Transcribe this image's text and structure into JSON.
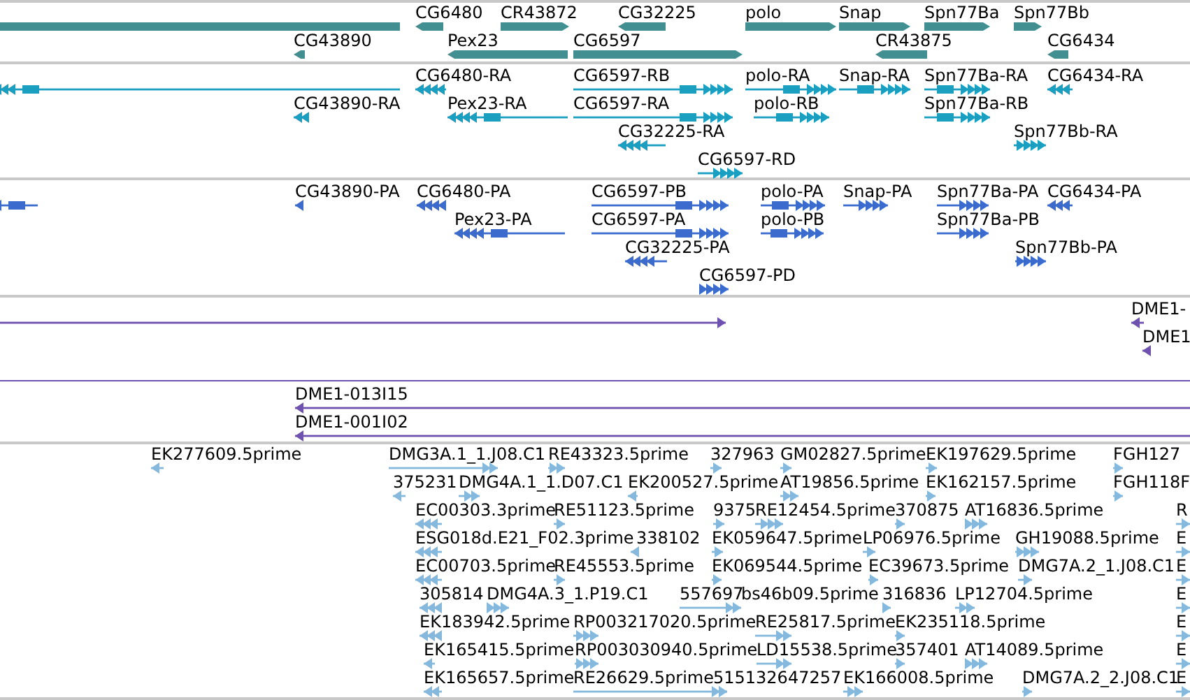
{
  "tracks": [
    {
      "kind": "gene",
      "color": "#428f92",
      "features": [
        {
          "reverse": true
        },
        {
          "label": "CG6480",
          "reverse": true
        },
        {
          "label": "CR43872",
          "reverse": false
        },
        {
          "label": "CG32225",
          "reverse": true
        },
        {
          "label": "polo",
          "reverse": false
        },
        {
          "label": "Snap",
          "reverse": false
        },
        {
          "label": "Spn77Ba",
          "reverse": false
        },
        {
          "label": "Spn77Bb",
          "reverse": false
        },
        {
          "label": "CG43890",
          "reverse": true
        },
        {
          "label": "Pex23",
          "reverse": true
        },
        {
          "label": "CG6597",
          "reverse": false
        },
        {
          "label": "CR43875",
          "reverse": true
        },
        {
          "label": "CG6434",
          "reverse": true
        }
      ]
    },
    {
      "kind": "transcript",
      "color": "#1b9fc0",
      "features": [
        {
          "reverse": true
        },
        {
          "label": "CG6480-RA",
          "reverse": true
        },
        {
          "label": "CG6597-RB",
          "reverse": false
        },
        {
          "label": "polo-RA",
          "reverse": false
        },
        {
          "label": "Snap-RA",
          "reverse": false
        },
        {
          "label": "Spn77Ba-RA",
          "reverse": false
        },
        {
          "label": "CG6434-RA",
          "reverse": true
        },
        {
          "label": "CG43890-RA",
          "reverse": true
        },
        {
          "label": "Pex23-RA",
          "reverse": true
        },
        {
          "label": "CG6597-RA",
          "reverse": false
        },
        {
          "label": "polo-RB",
          "reverse": false
        },
        {
          "label": "Spn77Ba-RB",
          "reverse": false
        },
        {
          "label": "CG32225-RA",
          "reverse": true
        },
        {
          "label": "Spn77Bb-RA",
          "reverse": false
        },
        {
          "label": "CG6597-RD",
          "reverse": false
        }
      ]
    },
    {
      "kind": "protein",
      "color": "#3b6bcc",
      "features": [
        {
          "reverse": true
        },
        {
          "label": "CG43890-PA",
          "reverse": true
        },
        {
          "label": "CG6480-PA",
          "reverse": true
        },
        {
          "label": "CG6597-PB",
          "reverse": false
        },
        {
          "label": "polo-PA",
          "reverse": false
        },
        {
          "label": "Snap-PA",
          "reverse": false
        },
        {
          "label": "Spn77Ba-PA",
          "reverse": false
        },
        {
          "label": "CG6434-PA",
          "reverse": true
        },
        {
          "label": "Pex23-PA",
          "reverse": true
        },
        {
          "label": "CG6597-PA",
          "reverse": false
        },
        {
          "label": "polo-PB",
          "reverse": false
        },
        {
          "label": "Spn77Ba-PB",
          "reverse": false
        },
        {
          "label": "CG32225-PA",
          "reverse": true
        },
        {
          "label": "Spn77Bb-PA",
          "reverse": false
        },
        {
          "label": "CG6597-PD",
          "reverse": false
        }
      ]
    },
    {
      "kind": "clone",
      "color": "#6f52b0",
      "features": [
        {
          "reverse": false
        },
        {
          "label": "DME1-",
          "reverse": true
        },
        {
          "label": "DME1",
          "reverse": true
        }
      ]
    },
    {
      "kind": "clone",
      "color": "#6f52b0",
      "features": [
        {
          "label": "DME1-013I15",
          "reverse": true
        },
        {
          "label": "DME1-001I02",
          "reverse": true
        }
      ]
    },
    {
      "kind": "est",
      "color": "#85b8dd",
      "features": [
        {
          "label": "EK277609.5prime",
          "reverse": true
        },
        {
          "label": "DMG3A.1_1.J08.C1",
          "reverse": false
        },
        {
          "label": "RE43323.5prime",
          "reverse": false
        },
        {
          "label": "327963",
          "reverse": false
        },
        {
          "label": "GM02827.5prime",
          "reverse": false
        },
        {
          "label": "EK197629.5prime",
          "reverse": false
        },
        {
          "label": "FGH127",
          "reverse": false
        },
        {
          "label": "375231",
          "reverse": true
        },
        {
          "label": "DMG4A.1_1.D07.C1",
          "reverse": false
        },
        {
          "label": "EK200527.5prime",
          "reverse": true
        },
        {
          "label": "AT19856.5prime",
          "reverse": false
        },
        {
          "label": "EK162157.5prime",
          "reverse": false
        },
        {
          "label": "FGH118F",
          "reverse": false
        },
        {
          "label": "EC00303.3prime",
          "reverse": true
        },
        {
          "label": "RE51123.5prime",
          "reverse": false
        },
        {
          "label": "9375",
          "reverse": false
        },
        {
          "label": "RE12454.5prime",
          "reverse": false
        },
        {
          "label": "370875",
          "reverse": false
        },
        {
          "label": "AT16836.5prime",
          "reverse": false
        },
        {
          "label": "R",
          "reverse": false
        },
        {
          "label": "ESG018d.E21_F02.3prime",
          "reverse": true
        },
        {
          "label": "338102",
          "reverse": true
        },
        {
          "label": "EK059647.5prime",
          "reverse": false
        },
        {
          "label": "LP06976.5prime",
          "reverse": false
        },
        {
          "label": "GH19088.5prime",
          "reverse": false
        },
        {
          "label": "E",
          "reverse": false
        },
        {
          "label": "EC00703.5prime",
          "reverse": true
        },
        {
          "label": "RE45553.5prime",
          "reverse": false
        },
        {
          "label": "EK069544.5prime",
          "reverse": false
        },
        {
          "label": "EC39673.5prime",
          "reverse": false
        },
        {
          "label": "DMG7A.2_1.J08.C1",
          "reverse": false
        },
        {
          "label": "E",
          "reverse": false
        },
        {
          "label": "305814",
          "reverse": true
        },
        {
          "label": "DMG4A.3_1.P19.C1",
          "reverse": false
        },
        {
          "label": "557697",
          "reverse": false
        },
        {
          "label": "bs46b09.5prime"
        },
        {
          "label": "316836",
          "reverse": false
        },
        {
          "label": "LP12704.5prime",
          "reverse": false
        },
        {
          "label": "E",
          "reverse": false
        },
        {
          "label": "EK183942.5prime",
          "reverse": true
        },
        {
          "label": "RP003217020.5prime",
          "reverse": false
        },
        {
          "label": "RE25817.5prime",
          "reverse": false
        },
        {
          "label": "EK235118.5prime",
          "reverse": false
        },
        {
          "label": "E",
          "reverse": false
        },
        {
          "label": "EK165415.5prime",
          "reverse": true
        },
        {
          "label": "RP003030940.5prime",
          "reverse": false
        },
        {
          "label": "LD15538.5prime",
          "reverse": false
        },
        {
          "label": "357401",
          "reverse": false
        },
        {
          "label": "AT14089.5prime",
          "reverse": false
        },
        {
          "label": "E",
          "reverse": false
        },
        {
          "label": "EK165657.5prime",
          "reverse": true
        },
        {
          "label": "RE26629.5prime",
          "reverse": false
        },
        {
          "label": "515132647257",
          "reverse": false
        },
        {
          "label": "EK166008.5prime",
          "reverse": false
        },
        {
          "label": "DMG7A.2_2.J08.C1",
          "reverse": false
        },
        {
          "label": "E",
          "reverse": false
        }
      ]
    }
  ]
}
